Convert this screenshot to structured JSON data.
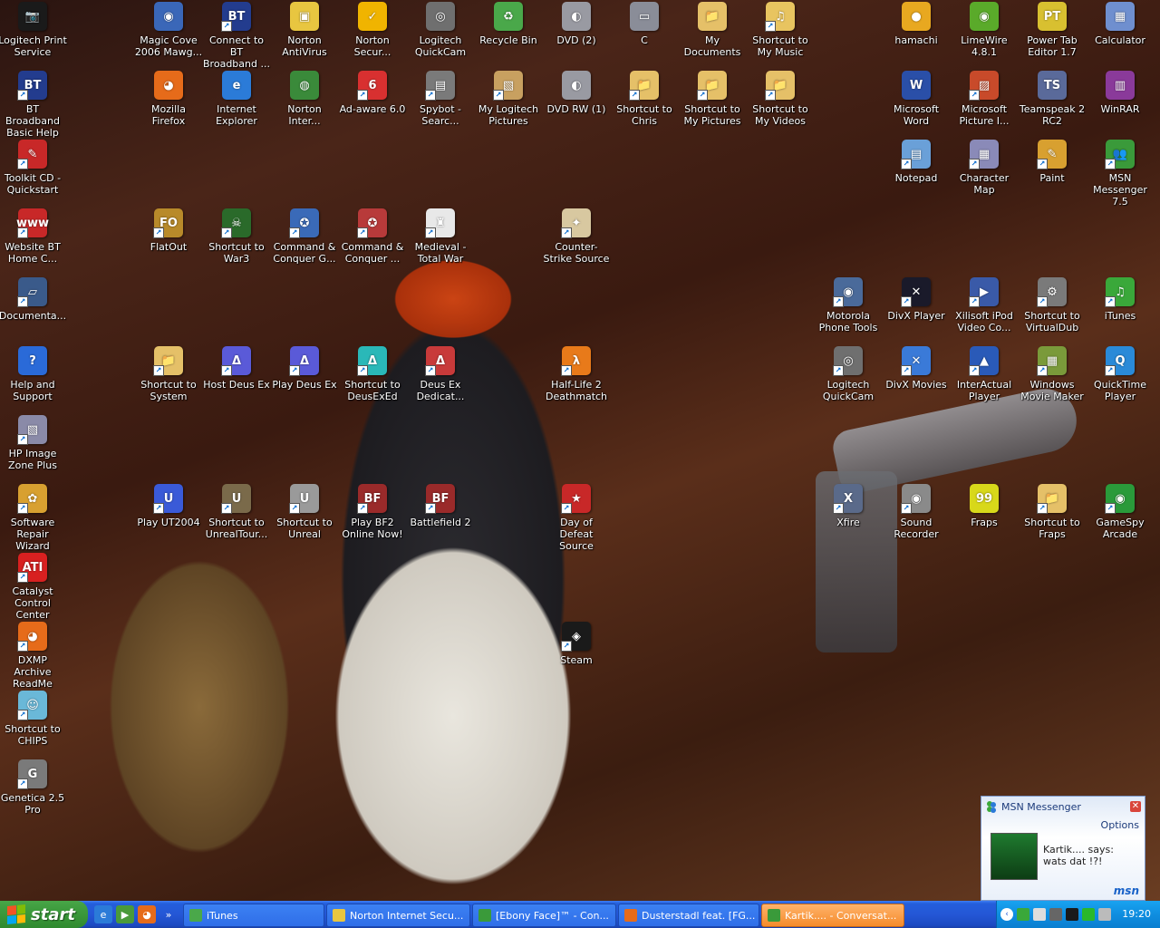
{
  "desktop_icons": [
    {
      "label": "Logitech Print Service",
      "glyph": "📷",
      "color": "#1a1a1a",
      "shortcut": false
    },
    {
      "label": "Magic Cove 2006 Mawg...",
      "glyph": "◉",
      "color": "#3a67b8",
      "shortcut": false
    },
    {
      "label": "Connect to BT Broadband ...",
      "glyph": "BT",
      "color": "#233c8e",
      "shortcut": true
    },
    {
      "label": "Norton AntiVirus",
      "glyph": "▣",
      "color": "#e8c640",
      "shortcut": false
    },
    {
      "label": "Norton Secur...",
      "glyph": "✓",
      "color": "#f0b400",
      "shortcut": false
    },
    {
      "label": "Logitech QuickCam",
      "glyph": "◎",
      "color": "#6f6f6f",
      "shortcut": false
    },
    {
      "label": "Recycle Bin",
      "glyph": "♻",
      "color": "#4aa84a",
      "shortcut": false
    },
    {
      "label": "DVD (2)",
      "glyph": "◐",
      "color": "#999aa2",
      "shortcut": false
    },
    {
      "label": "C",
      "glyph": "▭",
      "color": "#8a8d98",
      "shortcut": false
    },
    {
      "label": "My Documents",
      "glyph": "📁",
      "color": "#e5c068",
      "shortcut": false
    },
    {
      "label": "Shortcut to My Music",
      "glyph": "♫",
      "color": "#e8c460",
      "shortcut": true
    },
    {
      "label": "hamachi",
      "glyph": "●",
      "color": "#e8a820",
      "shortcut": false
    },
    {
      "label": "LimeWire 4.8.1",
      "glyph": "◉",
      "color": "#5aaa2a",
      "shortcut": false
    },
    {
      "label": "Power Tab Editor 1.7",
      "glyph": "PT",
      "color": "#d8c030",
      "shortcut": false
    },
    {
      "label": "Calculator",
      "glyph": "▦",
      "color": "#6f8fcf",
      "shortcut": false
    },
    {
      "label": "BT Broadband Basic Help",
      "glyph": "BT",
      "color": "#233c8e",
      "shortcut": true
    },
    {
      "label": "Mozilla Firefox",
      "glyph": "◕",
      "color": "#e66b1a",
      "shortcut": false
    },
    {
      "label": "Internet Explorer",
      "glyph": "e",
      "color": "#2b7bd8",
      "shortcut": false
    },
    {
      "label": "Norton Inter...",
      "glyph": "◍",
      "color": "#3a8a3a",
      "shortcut": false
    },
    {
      "label": "Ad-aware 6.0",
      "glyph": "6",
      "color": "#d83030",
      "shortcut": true
    },
    {
      "label": "Spybot - Searc...",
      "glyph": "▤",
      "color": "#7a7a7a",
      "shortcut": true
    },
    {
      "label": "My Logitech Pictures",
      "glyph": "▧",
      "color": "#c8a060",
      "shortcut": true
    },
    {
      "label": "DVD RW (1)",
      "glyph": "◐",
      "color": "#999aa2",
      "shortcut": false
    },
    {
      "label": "Shortcut to Chris",
      "glyph": "📁",
      "color": "#e5c068",
      "shortcut": true
    },
    {
      "label": "Shortcut to My Pictures",
      "glyph": "📁",
      "color": "#e5c068",
      "shortcut": true
    },
    {
      "label": "Shortcut to My Videos",
      "glyph": "📁",
      "color": "#e5c068",
      "shortcut": true
    },
    {
      "label": "Microsoft Word",
      "glyph": "W",
      "color": "#2a4fa8",
      "shortcut": false
    },
    {
      "label": "Microsoft Picture I...",
      "glyph": "▨",
      "color": "#c84a2a",
      "shortcut": true
    },
    {
      "label": "Teamspeak 2 RC2",
      "glyph": "TS",
      "color": "#5a6a9a",
      "shortcut": false
    },
    {
      "label": "WinRAR",
      "glyph": "▥",
      "color": "#8a3a9a",
      "shortcut": false
    },
    {
      "label": "Toolkit CD - Quickstart",
      "glyph": "✎",
      "color": "#c82828",
      "shortcut": true
    },
    {
      "label": "Notepad",
      "glyph": "▤",
      "color": "#6aa0d8",
      "shortcut": true
    },
    {
      "label": "Character Map",
      "glyph": "▦",
      "color": "#8a8ab8",
      "shortcut": true
    },
    {
      "label": "Paint",
      "glyph": "✎",
      "color": "#d8a030",
      "shortcut": true
    },
    {
      "label": "MSN Messenger 7.5",
      "glyph": "👥",
      "color": "#3a9a3a",
      "shortcut": true
    },
    {
      "label": "Website BT Home C...",
      "glyph": "www",
      "color": "#c82828",
      "shortcut": true
    },
    {
      "label": "FlatOut",
      "glyph": "FO",
      "color": "#b88a2a",
      "shortcut": true
    },
    {
      "label": "Shortcut to War3",
      "glyph": "☠",
      "color": "#2a6a2a",
      "shortcut": true
    },
    {
      "label": "Command & Conquer G...",
      "glyph": "✪",
      "color": "#3a6ab8",
      "shortcut": true
    },
    {
      "label": "Command & Conquer ...",
      "glyph": "✪",
      "color": "#b83a3a",
      "shortcut": true
    },
    {
      "label": "Medieval - Total War",
      "glyph": "♜",
      "color": "#e8e8e8",
      "shortcut": true
    },
    {
      "label": "Counter-Strike Source",
      "glyph": "✦",
      "color": "#d8c8a0",
      "shortcut": true
    },
    {
      "label": "Documenta...",
      "glyph": "▱",
      "color": "#3a5a8a",
      "shortcut": true
    },
    {
      "label": "Motorola Phone Tools",
      "glyph": "◉",
      "color": "#4a6a9a",
      "shortcut": true
    },
    {
      "label": "DivX Player",
      "glyph": "✕",
      "color": "#1a1a2a",
      "shortcut": true
    },
    {
      "label": "Xilisoft iPod Video Co...",
      "glyph": "▶",
      "color": "#3a5aa8",
      "shortcut": true
    },
    {
      "label": "Shortcut to VirtualDub",
      "glyph": "⚙",
      "color": "#7a7a7a",
      "shortcut": true
    },
    {
      "label": "iTunes",
      "glyph": "♫",
      "color": "#3aa83a",
      "shortcut": true
    },
    {
      "label": "Help and Support",
      "glyph": "?",
      "color": "#2a6ad8",
      "shortcut": false
    },
    {
      "label": "Shortcut to System",
      "glyph": "📁",
      "color": "#e5c068",
      "shortcut": true
    },
    {
      "label": "Host Deus Ex",
      "glyph": "Δ",
      "color": "#5a5ad8",
      "shortcut": true
    },
    {
      "label": "Play Deus Ex",
      "glyph": "Δ",
      "color": "#5a5ad8",
      "shortcut": true
    },
    {
      "label": "Shortcut to DeusExEd",
      "glyph": "Δ",
      "color": "#2ab8b8",
      "shortcut": true
    },
    {
      "label": "Deus Ex Dedicat...",
      "glyph": "Δ",
      "color": "#c83a3a",
      "shortcut": true
    },
    {
      "label": "Half-Life 2 Deathmatch",
      "glyph": "λ",
      "color": "#e87a1a",
      "shortcut": true
    },
    {
      "label": "Logitech QuickCam",
      "glyph": "◎",
      "color": "#6f6f6f",
      "shortcut": true
    },
    {
      "label": "DivX Movies",
      "glyph": "✕",
      "color": "#3a7ad8",
      "shortcut": true
    },
    {
      "label": "InterActual Player",
      "glyph": "▲",
      "color": "#2a5ab8",
      "shortcut": true
    },
    {
      "label": "Windows Movie Maker",
      "glyph": "▦",
      "color": "#7a9a3a",
      "shortcut": true
    },
    {
      "label": "QuickTime Player",
      "glyph": "Q",
      "color": "#2a8ad8",
      "shortcut": true
    },
    {
      "label": "HP Image Zone Plus",
      "glyph": "▧",
      "color": "#8a8aa8",
      "shortcut": true
    },
    {
      "label": "Software Repair Wizard",
      "glyph": "✿",
      "color": "#d8a030",
      "shortcut": true
    },
    {
      "label": "Play UT2004",
      "glyph": "U",
      "color": "#3a5ad8",
      "shortcut": true
    },
    {
      "label": "Shortcut to UnrealTour...",
      "glyph": "U",
      "color": "#7a6a4a",
      "shortcut": true
    },
    {
      "label": "Shortcut to Unreal",
      "glyph": "U",
      "color": "#9a9a9a",
      "shortcut": true
    },
    {
      "label": "Play BF2 Online Now!",
      "glyph": "BF",
      "color": "#9a2a2a",
      "shortcut": true
    },
    {
      "label": "Battlefield 2",
      "glyph": "BF",
      "color": "#9a2a2a",
      "shortcut": true
    },
    {
      "label": "Day of Defeat Source",
      "glyph": "★",
      "color": "#c82828",
      "shortcut": true
    },
    {
      "label": "Xfire",
      "glyph": "X",
      "color": "#5a6a8a",
      "shortcut": true
    },
    {
      "label": "Sound Recorder",
      "glyph": "◉",
      "color": "#8a8a8a",
      "shortcut": true
    },
    {
      "label": "Fraps",
      "glyph": "99",
      "color": "#d8d81a",
      "shortcut": false
    },
    {
      "label": "Shortcut to Fraps",
      "glyph": "📁",
      "color": "#e5c068",
      "shortcut": true
    },
    {
      "label": "GameSpy Arcade",
      "glyph": "◉",
      "color": "#2a9a3a",
      "shortcut": true
    },
    {
      "label": "Catalyst Control Center",
      "glyph": "ATI",
      "color": "#d82020",
      "shortcut": true
    },
    {
      "label": "Steam",
      "glyph": "◈",
      "color": "#1a1a1a",
      "shortcut": true
    },
    {
      "label": "DXMP Archive ReadMe",
      "glyph": "◕",
      "color": "#e66b1a",
      "shortcut": true
    },
    {
      "label": "Shortcut to CHIPS",
      "glyph": "☺",
      "color": "#6ab8d8",
      "shortcut": true
    },
    {
      "label": "Genetica 2.5 Pro",
      "glyph": "G",
      "color": "#7a7a7a",
      "shortcut": true
    }
  ],
  "taskbar": {
    "start_label": "start",
    "quick_launch": [
      "ie-icon",
      "media-player-icon",
      "firefox-icon",
      "more-chevron-icon"
    ],
    "quick_launch_more": "»",
    "tasks": [
      {
        "label": "iTunes",
        "color": "#4aa84a",
        "active": false
      },
      {
        "label": "Norton Internet Secu...",
        "color": "#e8c640",
        "active": false
      },
      {
        "label": "[Ebony Face]™ - Con...",
        "color": "#3a9a3a",
        "active": false
      },
      {
        "label": "Dusterstadl feat. [FG...",
        "color": "#e66b1a",
        "active": false
      },
      {
        "label": "Kartik.... - Conversat...",
        "color": "#3a9a3a",
        "active": true
      }
    ],
    "clock": "19:20"
  },
  "msn_popup": {
    "title": "MSN Messenger",
    "options": "Options",
    "message": "Kartik.... says: wats dat !?!",
    "logo": "msn"
  },
  "colors": {
    "taskbar_blue": "#245edb",
    "start_green": "#3c9a3c",
    "tray_blue": "#0f8ee0",
    "active_task": "#f58b2b"
  }
}
